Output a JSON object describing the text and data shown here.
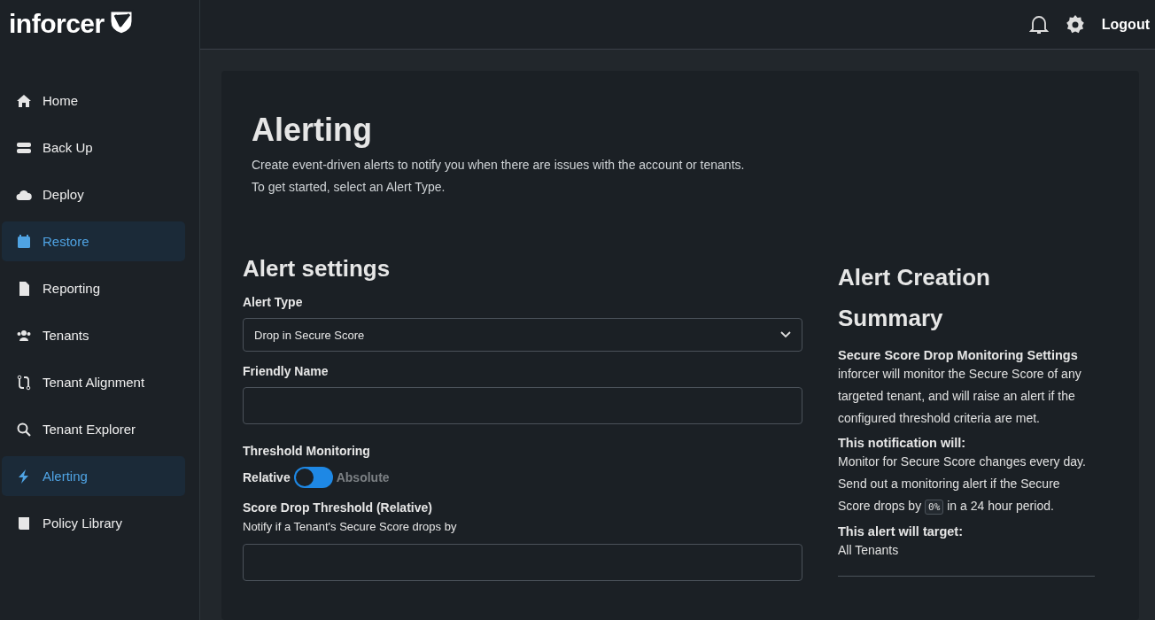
{
  "brand": {
    "name": "inforcer"
  },
  "topbar": {
    "logout": "Logout"
  },
  "sidebar": {
    "items": [
      {
        "label": "Home",
        "selected": false
      },
      {
        "label": "Back Up",
        "selected": false
      },
      {
        "label": "Deploy",
        "selected": false
      },
      {
        "label": "Restore",
        "selected": true
      },
      {
        "label": "Reporting",
        "selected": false
      },
      {
        "label": "Tenants",
        "selected": false
      },
      {
        "label": "Tenant Alignment",
        "selected": false
      },
      {
        "label": "Tenant Explorer",
        "selected": false
      },
      {
        "label": "Alerting",
        "selected": true
      },
      {
        "label": "Policy Library",
        "selected": false
      }
    ]
  },
  "header": {
    "title": "Alerting",
    "lines": [
      "Create event-driven alerts to notify you when there are issues with the account or tenants.",
      "To get started, select an Alert Type."
    ]
  },
  "settings": {
    "title": "Alert settings",
    "alert_type": {
      "label": "Alert Type",
      "value": "Drop in Secure Score"
    },
    "friendly_name": {
      "label": "Friendly Name"
    },
    "threshold_monitoring": {
      "label": "Threshold Monitoring",
      "options": [
        {
          "label": "Relative",
          "selected": true
        },
        {
          "label": "Absolute",
          "selected": false
        }
      ]
    },
    "score_drop": {
      "label": "Score Drop Threshold (Relative)",
      "hint": "Notify if a Tenant's Secure Score drops by"
    }
  },
  "summary": {
    "title": "Alert Creation Summary",
    "sections": [
      {
        "heading": "Secure Score Drop Monitoring Settings",
        "text": "inforcer will monitor the Secure Score of any targeted tenant, and will raise an alert if the configured threshold criteria are met."
      },
      {
        "heading": "This notification will:",
        "text": "Monitor for Secure Score changes every day.",
        "text2_before": "Send out a monitoring alert if the Secure Score drops by",
        "code": "0%",
        "text2_after": "in a 24 hour period."
      },
      {
        "heading": "This alert will target:",
        "text": "All Tenants"
      }
    ]
  }
}
